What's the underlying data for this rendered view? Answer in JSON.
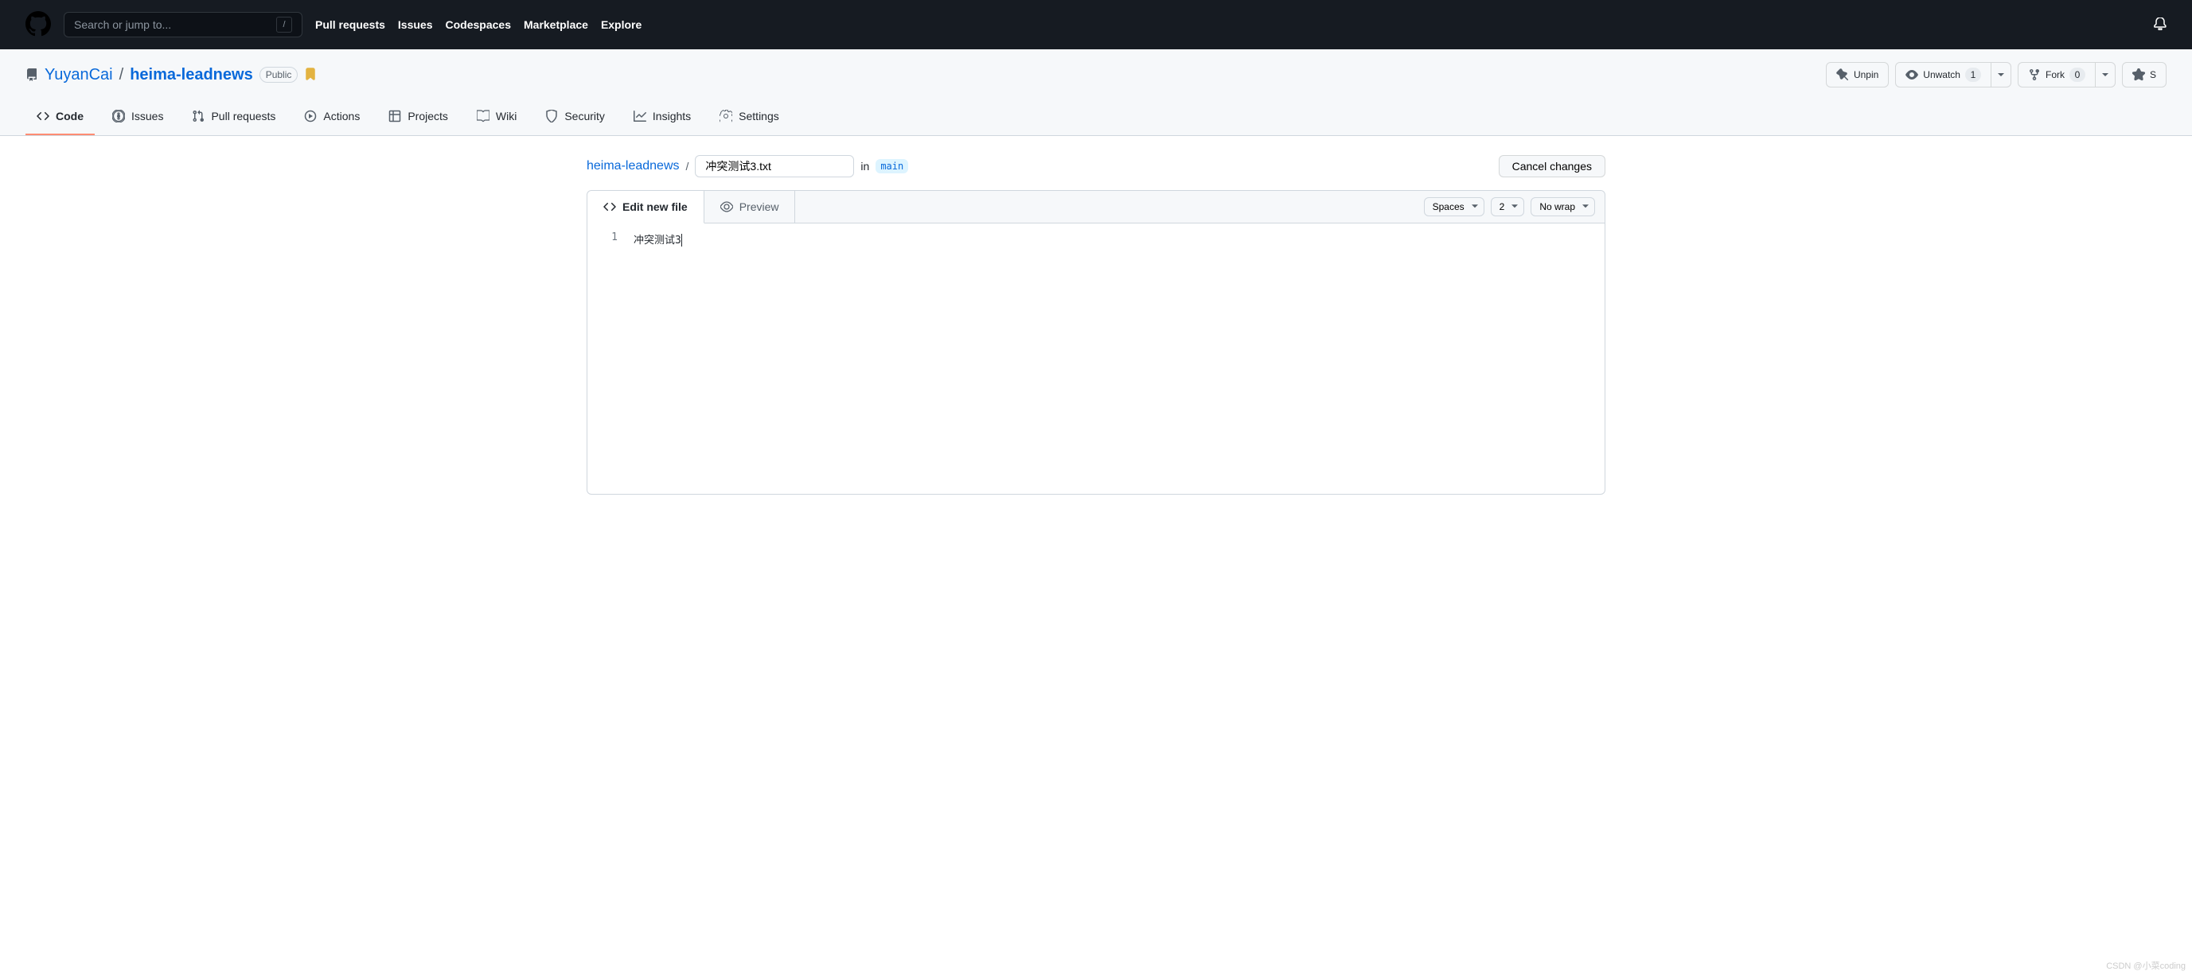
{
  "header": {
    "search_placeholder": "Search or jump to...",
    "search_key": "/",
    "nav": [
      "Pull requests",
      "Issues",
      "Codespaces",
      "Marketplace",
      "Explore"
    ]
  },
  "repo": {
    "owner": "YuyanCai",
    "name": "heima-leadnews",
    "visibility": "Public",
    "actions": {
      "unpin": "Unpin",
      "unwatch": "Unwatch",
      "watch_count": "1",
      "fork": "Fork",
      "fork_count": "0",
      "star": "S"
    },
    "tabs": [
      {
        "id": "code",
        "label": "Code"
      },
      {
        "id": "issues",
        "label": "Issues"
      },
      {
        "id": "pulls",
        "label": "Pull requests"
      },
      {
        "id": "actions",
        "label": "Actions"
      },
      {
        "id": "projects",
        "label": "Projects"
      },
      {
        "id": "wiki",
        "label": "Wiki"
      },
      {
        "id": "security",
        "label": "Security"
      },
      {
        "id": "insights",
        "label": "Insights"
      },
      {
        "id": "settings",
        "label": "Settings"
      }
    ]
  },
  "file_editor": {
    "repo_crumb": "heima-leadnews",
    "filename": "冲突测试3.txt",
    "in_label": "in",
    "branch": "main",
    "cancel_label": "Cancel changes",
    "tabs": {
      "edit": "Edit new file",
      "preview": "Preview"
    },
    "options": {
      "indent_mode": "Spaces",
      "indent_size": "2",
      "wrap": "No wrap"
    },
    "lines": [
      {
        "num": "1",
        "text": "冲突测试3"
      }
    ]
  },
  "watermark": "CSDN @小菜coding"
}
